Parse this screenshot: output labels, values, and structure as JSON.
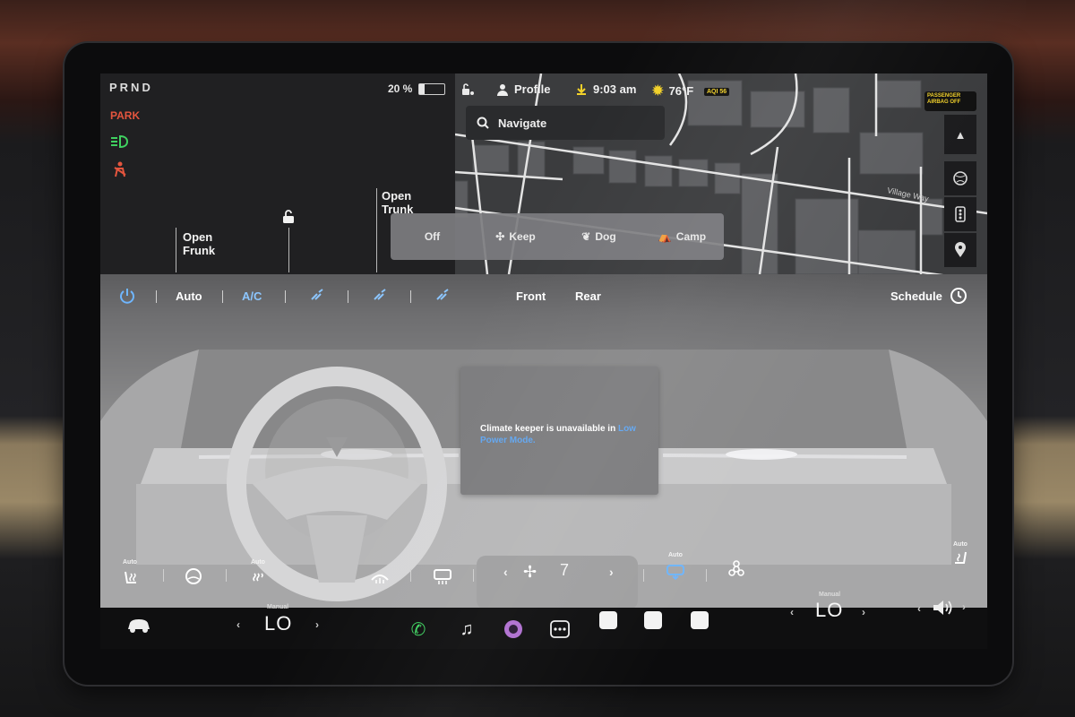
{
  "status": {
    "gear": "PRND",
    "park_label": "PARK",
    "battery_percent": "20 %",
    "battery_level": 0.2
  },
  "car": {
    "frunk_label": "Open\nFrunk",
    "trunk_label": "Open\nTrunk"
  },
  "topbar": {
    "profile": "Profile",
    "time": "9:03 am",
    "temperature": "76°F",
    "aqi": "AQI 56",
    "airbag": "PASSENGER AIRBAG OFF"
  },
  "map": {
    "search_placeholder": "Navigate",
    "street_label": "Village Way"
  },
  "climate_keeper": {
    "options": [
      "Off",
      "Keep",
      "Dog",
      "Camp"
    ]
  },
  "climate": {
    "auto_label": "Auto",
    "ac_label": "A/C",
    "front_label": "Front",
    "rear_label": "Rear",
    "schedule_label": "Schedule",
    "message_part1": "Climate keeper is unavailable in",
    "message_highlight": "Low Power Mode.",
    "fan_speed": "7",
    "seat_auto_label": "Auto",
    "accent_color": "#62a6f0"
  },
  "dock": {
    "left_mode": "Manual",
    "left_temp": "LO",
    "right_mode": "Manual",
    "right_temp": "LO"
  }
}
